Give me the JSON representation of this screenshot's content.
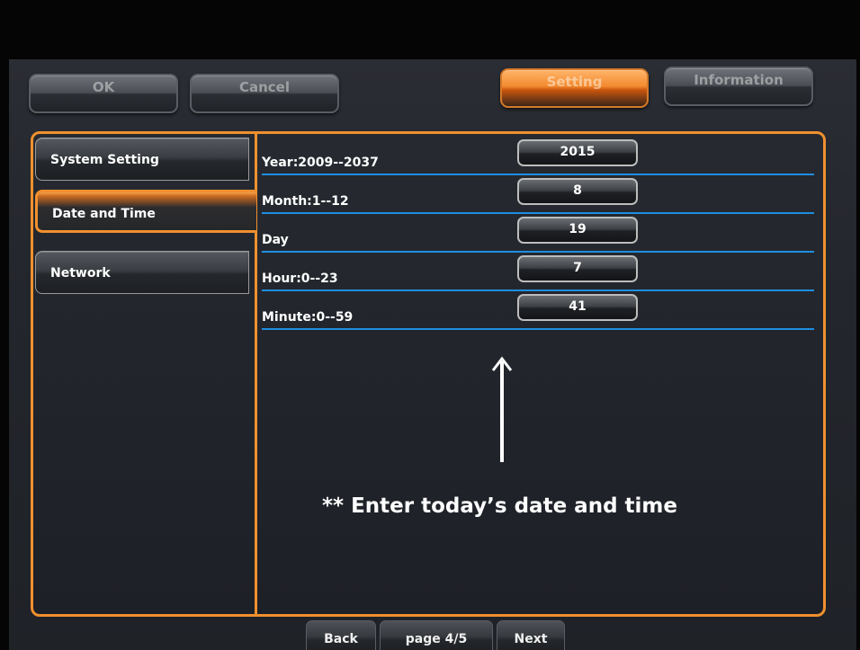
{
  "topbar": {
    "ok_label": "OK",
    "cancel_label": "Cancel",
    "setting_label": "Setting",
    "information_label": "Information"
  },
  "sidebar": {
    "items": [
      {
        "label": "System Setting"
      },
      {
        "label": "Date and Time"
      },
      {
        "label": "Network"
      }
    ],
    "selected": "Date and Time"
  },
  "fields": [
    {
      "label": "Year:2009--2037",
      "value": "2015"
    },
    {
      "label": "Month:1--12",
      "value": "8"
    },
    {
      "label": "Day",
      "value": "19"
    },
    {
      "label": "Hour:0--23",
      "value": "7"
    },
    {
      "label": "Minute:0--59",
      "value": "41"
    }
  ],
  "annotation": {
    "text": "** Enter today’s date and time"
  },
  "pager": {
    "back_label": "Back",
    "page_label": "page 4/5",
    "next_label": "Next"
  },
  "colors": {
    "accent": "#f0902e",
    "row_line": "#1f8ee0",
    "background": "#23262c"
  },
  "icons": {
    "annotation_arrow": "up-arrow-icon"
  }
}
